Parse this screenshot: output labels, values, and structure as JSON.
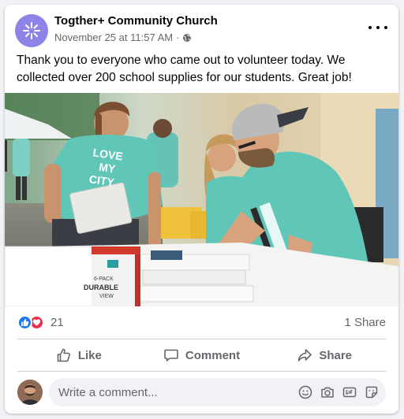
{
  "post": {
    "page_name": "Togther+ Community Church",
    "timestamp": "November 25 at 11:57 AM",
    "audience_icon": "globe-icon",
    "text": "Thank you to everyone who came out to volunteer today. We collected over 200 school supplies for our students. Great job!",
    "photo_shirt_text": [
      "LOVE",
      "MY",
      "CITY"
    ],
    "photo_box_text": [
      "6-PACK",
      "DURABLE",
      "VIEW"
    ]
  },
  "stats": {
    "reaction_icons": [
      "like-icon",
      "love-icon"
    ],
    "reaction_count": "21",
    "shares": "1 Share"
  },
  "actions": {
    "like": "Like",
    "comment": "Comment",
    "share": "Share"
  },
  "comment": {
    "placeholder": "Write a comment...",
    "icons": [
      "emoji-icon",
      "camera-icon",
      "gif-icon",
      "sticker-icon"
    ]
  },
  "colors": {
    "accent": "#1877f2",
    "love": "#f02849",
    "avatar": "#8e84e8",
    "secondary_text": "#65676b"
  }
}
